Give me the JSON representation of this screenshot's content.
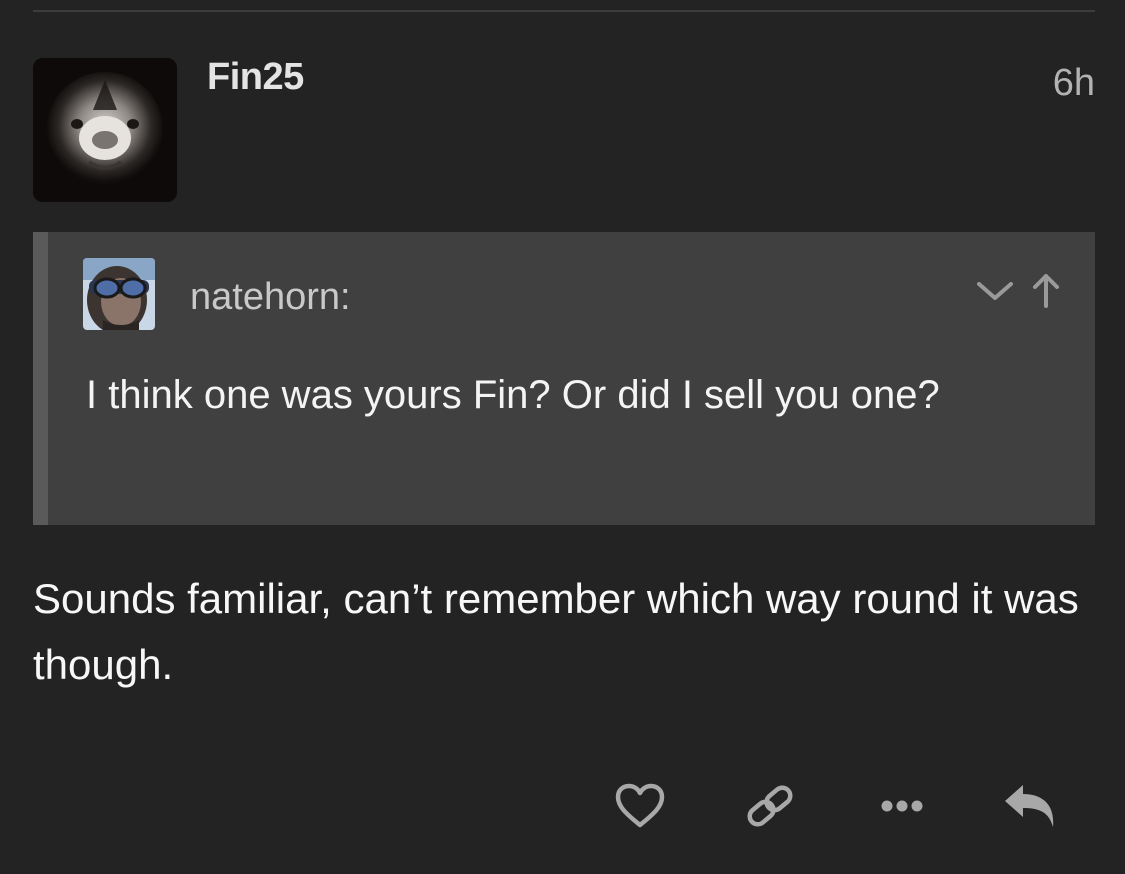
{
  "post": {
    "username": "Fin25",
    "timestamp": "6h",
    "avatar_icon": "dog-face-avatar",
    "quote": {
      "author": "natehorn:",
      "avatar_icon": "person-with-glasses-avatar",
      "text": "I think one was yours Fin? Or did I sell you one?",
      "actions": [
        "chevron-down-icon",
        "arrow-up-icon"
      ]
    },
    "body": "Sounds familiar, can’t remember which way round it was though."
  },
  "actions": [
    "heart-icon",
    "link-icon",
    "more-icon",
    "reply-icon"
  ],
  "colors": {
    "background": "#232323",
    "quote_background": "#404040",
    "quote_border": "#5a5a5a",
    "text": "#f2f2f2",
    "muted": "#b3b3b3",
    "icon": "#a8a8a8"
  }
}
